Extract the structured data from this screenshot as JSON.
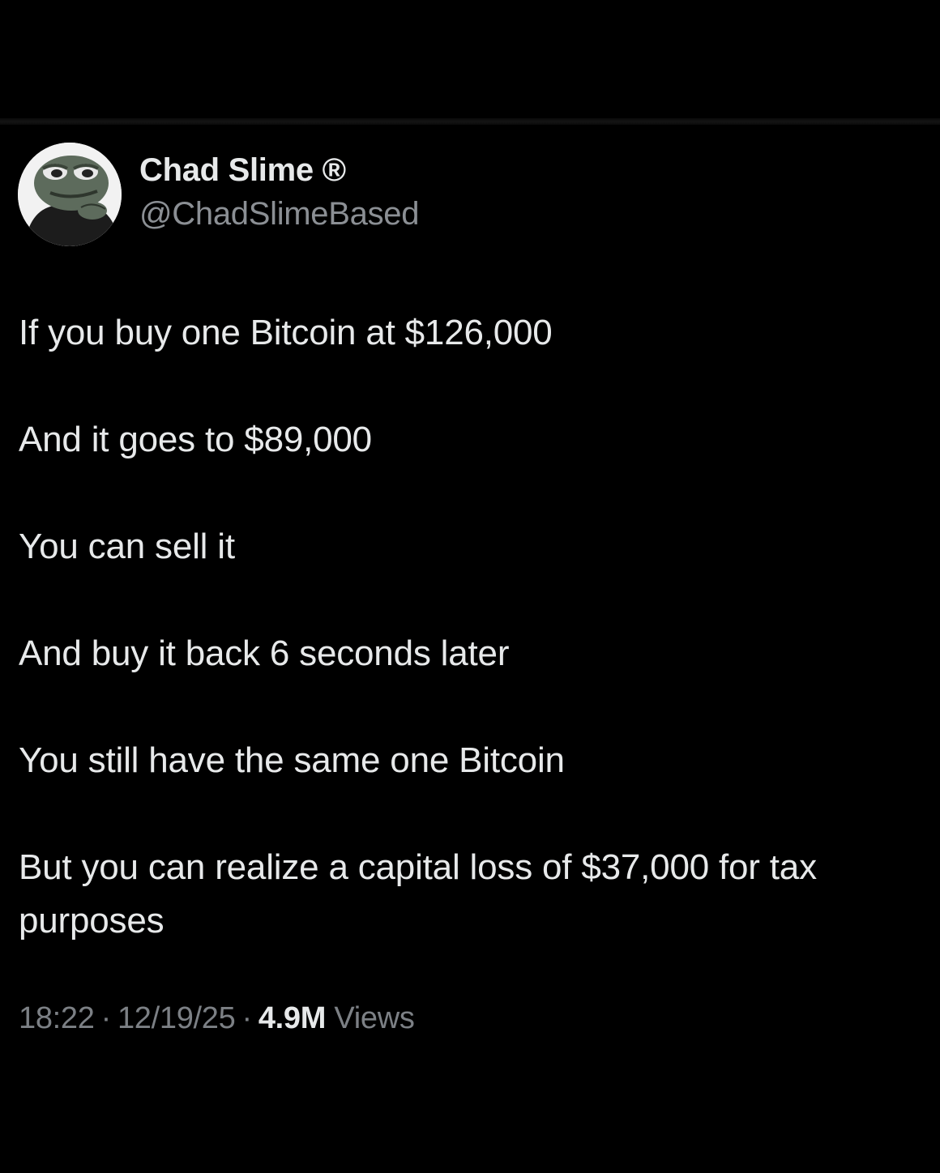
{
  "author": {
    "display_name": "Chad Slime ®",
    "handle": "@ChadSlimeBased",
    "avatar_icon": "pepe-frog-avatar-icon"
  },
  "tweet": {
    "lines": [
      "If you buy one Bitcoin at $126,000",
      "And it goes to $89,000",
      "You can sell it",
      "And buy it back 6 seconds later",
      "You still have the same one Bitcoin",
      "But you can realize a capital loss of $37,000 for tax purposes"
    ]
  },
  "meta": {
    "time": "18:22",
    "separator": "·",
    "date": "12/19/25",
    "views_count": "4.9M",
    "views_label": "Views"
  },
  "colors": {
    "background": "#000000",
    "primary_text": "#e7e9ea",
    "secondary_text": "#8b8f94"
  }
}
